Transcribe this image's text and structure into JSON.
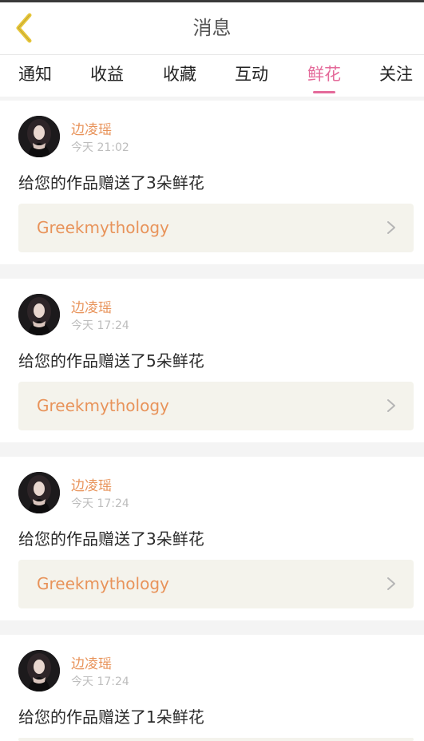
{
  "header": {
    "title": "消息"
  },
  "tabs": [
    {
      "label": "通知",
      "active": false
    },
    {
      "label": "收益",
      "active": false
    },
    {
      "label": "收藏",
      "active": false
    },
    {
      "label": "互动",
      "active": false
    },
    {
      "label": "鲜花",
      "active": true
    },
    {
      "label": "关注",
      "active": false
    }
  ],
  "colors": {
    "accent_pink": "#e46a9a",
    "name_orange": "#e8935a",
    "back_yellow": "#e7c63a",
    "card_bg": "#f4f3ec"
  },
  "messages": [
    {
      "sender": "边凌瑶",
      "time": "今天 21:02",
      "text": "给您的作品赠送了3朵鲜花",
      "work": "Greekmythology"
    },
    {
      "sender": "边凌瑶",
      "time": "今天 17:24",
      "text": "给您的作品赠送了5朵鲜花",
      "work": "Greekmythology"
    },
    {
      "sender": "边凌瑶",
      "time": "今天 17:24",
      "text": "给您的作品赠送了3朵鲜花",
      "work": "Greekmythology"
    },
    {
      "sender": "边凌瑶",
      "time": "今天 17:24",
      "text": "给您的作品赠送了1朵鲜花",
      "work": "Greekmythology"
    }
  ],
  "icons": {
    "back": "chevron-left-icon",
    "row_arrow": "chevron-right-icon",
    "avatar": "user-avatar"
  }
}
